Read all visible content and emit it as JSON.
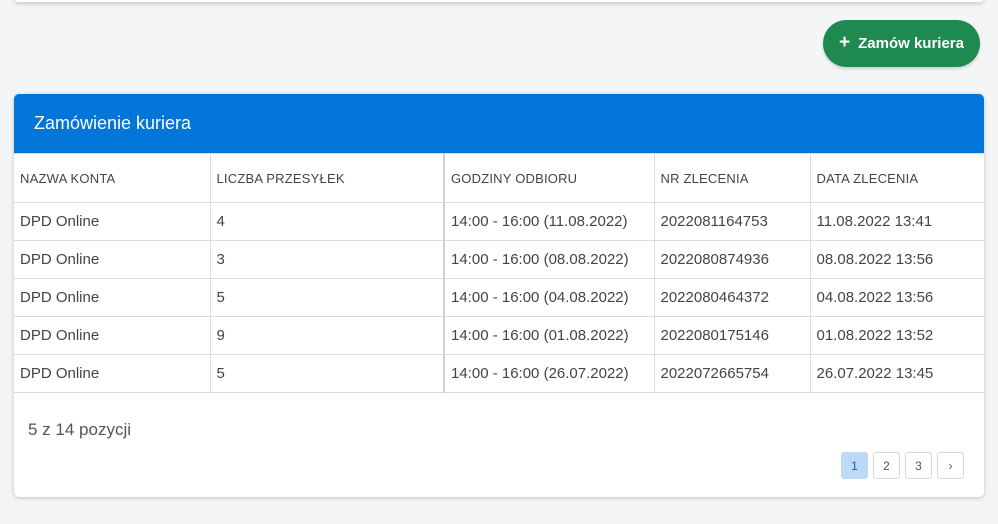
{
  "header": {
    "order_button_label": "Zamów kuriera",
    "order_button_icon": "plus-icon"
  },
  "panel": {
    "title": "Zamówienie kuriera",
    "columns": [
      "NAZWA KONTA",
      "LICZBA PRZESYŁEK",
      "GODZINY ODBIORU",
      "NR ZLECENIA",
      "DATA ZLECENIA"
    ],
    "rows": [
      [
        "DPD Online",
        "4",
        "14:00 - 16:00 (11.08.2022)",
        "2022081164753",
        "11.08.2022 13:41"
      ],
      [
        "DPD Online",
        "3",
        "14:00 - 16:00 (08.08.2022)",
        "2022080874936",
        "08.08.2022 13:56"
      ],
      [
        "DPD Online",
        "5",
        "14:00 - 16:00 (04.08.2022)",
        "2022080464372",
        "04.08.2022 13:56"
      ],
      [
        "DPD Online",
        "9",
        "14:00 - 16:00 (01.08.2022)",
        "2022080175146",
        "01.08.2022 13:52"
      ],
      [
        "DPD Online",
        "5",
        "14:00 - 16:00 (26.07.2022)",
        "2022072665754",
        "26.07.2022 13:45"
      ]
    ],
    "summary": "5 z 14 pozycji"
  },
  "pagination": {
    "pages": [
      "1",
      "2",
      "3"
    ],
    "active_page": "1",
    "next_symbol": "›"
  },
  "colors": {
    "header_blue": "#0275d8",
    "button_green": "#1e8a4f",
    "active_page_bg": "#bcd9f5"
  }
}
